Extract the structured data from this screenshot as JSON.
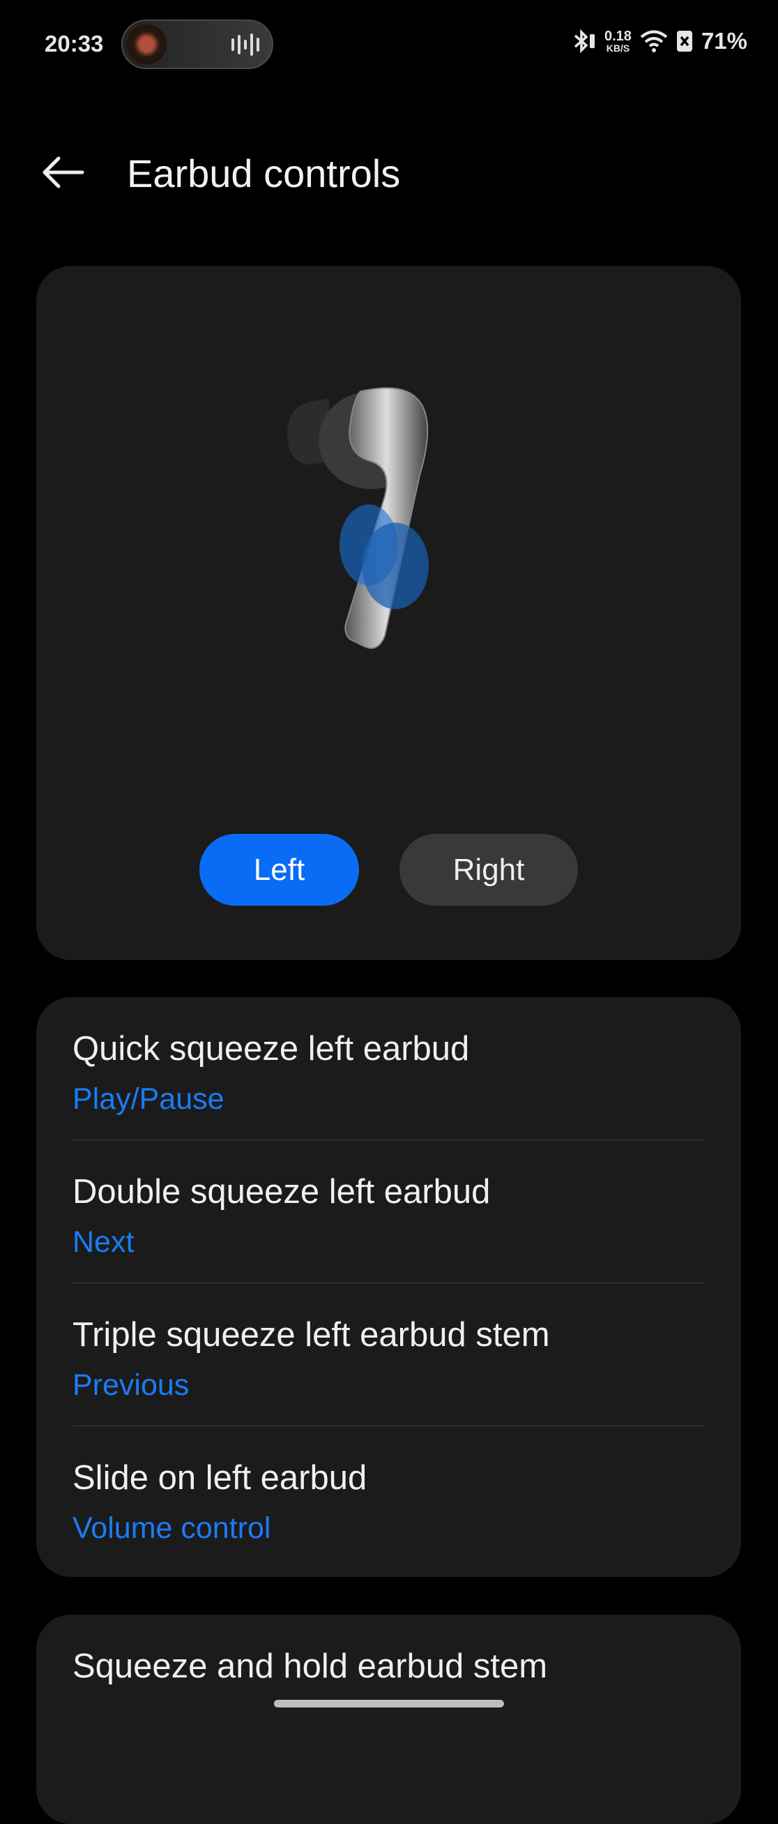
{
  "status_bar": {
    "time": "20:33",
    "net_speed_value": "0.18",
    "net_speed_unit": "KB/S",
    "battery": "71%",
    "icons": [
      "media-pill-icon",
      "bluetooth-icon",
      "wifi-icon",
      "battery-saver-icon"
    ]
  },
  "header": {
    "title": "Earbud controls",
    "back_icon": "arrow-left-icon"
  },
  "earbud_selector": {
    "left_label": "Left",
    "right_label": "Right",
    "selected": "Left",
    "accent": "#0a6cf5"
  },
  "controls": [
    {
      "title": "Quick squeeze left earbud",
      "value": "Play/Pause"
    },
    {
      "title": "Double squeeze left earbud",
      "value": "Next"
    },
    {
      "title": "Triple squeeze left earbud stem",
      "value": "Previous"
    },
    {
      "title": "Slide on left earbud",
      "value": "Volume control"
    }
  ],
  "extra": {
    "title": "Squeeze and hold earbud stem"
  }
}
